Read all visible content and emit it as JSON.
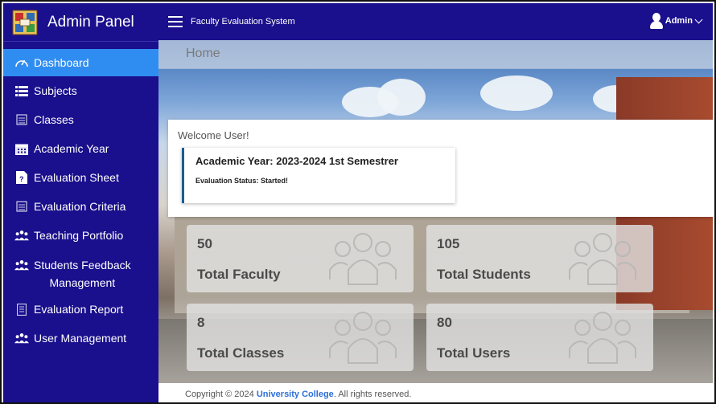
{
  "brand": {
    "title": "Admin Panel"
  },
  "topbar": {
    "system_title": "Faculty Evaluation System",
    "user": "Admin"
  },
  "sidebar": {
    "items": [
      {
        "label": "Dashboard",
        "icon": "dashboard-icon",
        "active": true
      },
      {
        "label": "Subjects",
        "icon": "list-icon"
      },
      {
        "label": "Classes",
        "icon": "classes-icon"
      },
      {
        "label": "Academic Year",
        "icon": "calendar-icon"
      },
      {
        "label": "Evaluation Sheet",
        "icon": "question-sheet-icon"
      },
      {
        "label": "Evaluation Criteria",
        "icon": "criteria-icon"
      },
      {
        "label": "Teaching Portfolio",
        "icon": "group-icon"
      },
      {
        "label_line1": "Students Feedback",
        "label_line2": "Management",
        "icon": "group-icon"
      },
      {
        "label": "Evaluation Report",
        "icon": "report-icon"
      },
      {
        "label": "User Management",
        "icon": "group-icon"
      }
    ]
  },
  "main": {
    "page_title": "Home",
    "welcome": "Welcome User!",
    "academic_year": "Academic Year: 2023-2024 1st Semestrer",
    "evaluation_status": "Evaluation Status: Started!"
  },
  "stats": [
    {
      "value": "50",
      "label": "Total Faculty"
    },
    {
      "value": "105",
      "label": "Total Students"
    },
    {
      "value": "8",
      "label": "Total Classes"
    },
    {
      "value": "80",
      "label": "Total Users"
    }
  ],
  "footer": {
    "prefix": "Copyright © 2024 ",
    "college": "University College",
    "suffix": ". All rights reserved."
  },
  "colors": {
    "sidebar": "#1a0f8c",
    "active": "#2f8df2",
    "accent": "#2d6fd8"
  }
}
